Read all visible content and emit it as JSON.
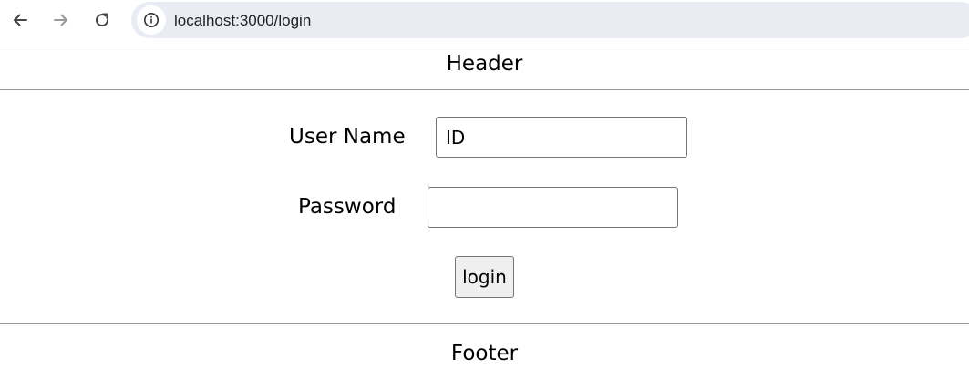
{
  "browser": {
    "url": "localhost:3000/login",
    "icons": {
      "back": "arrow-left-icon",
      "forward": "arrow-right-icon",
      "reload": "reload-icon",
      "site_info": "info-icon"
    }
  },
  "page": {
    "header": "Header",
    "footer": "Footer"
  },
  "login_form": {
    "username_label": "User Name",
    "username_value": "ID",
    "password_label": "Password",
    "password_value": "",
    "login_button": "login"
  }
}
